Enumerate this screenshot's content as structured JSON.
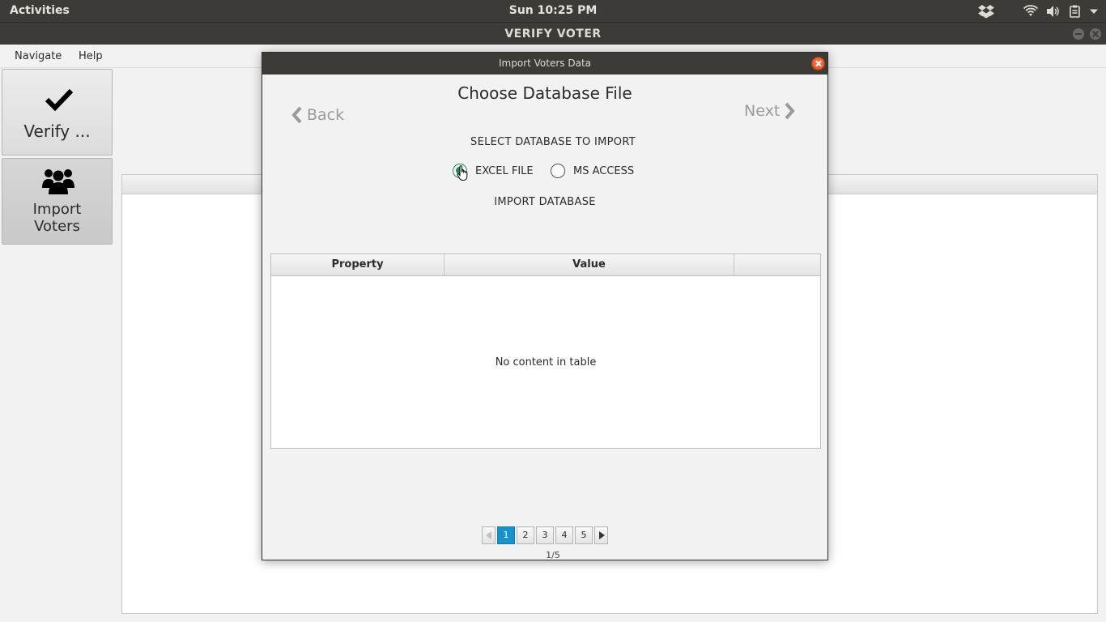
{
  "system": {
    "activities": "Activities",
    "clock": "Sun 10:25 PM"
  },
  "window": {
    "title": "VERIFY VOTER"
  },
  "menu": {
    "navigate": "Navigate",
    "help": "Help"
  },
  "sidebar": {
    "verify_label": "Verify ...",
    "import_label_line1": "Import",
    "import_label_line2": "Voters"
  },
  "dialog": {
    "title": "Import Voters Data",
    "heading": "Choose Database File",
    "back_label": "Back",
    "next_label": "Next",
    "select_label": "SELECT DATABASE TO IMPORT",
    "radio_excel": "EXCEL FILE",
    "radio_access": "MS ACCESS",
    "import_button": "IMPORT DATABASE",
    "table": {
      "columns": [
        "Property",
        "Value",
        ""
      ],
      "empty_message": "No content in table"
    },
    "pager": {
      "pages": [
        "1",
        "2",
        "3",
        "4",
        "5"
      ],
      "current": "1",
      "info": "1/5"
    }
  },
  "colors": {
    "accent": "#1b91c9",
    "radio_selected": "#1e8f4e",
    "close_button": "#df4b16",
    "topbar": "#3c3b37"
  }
}
